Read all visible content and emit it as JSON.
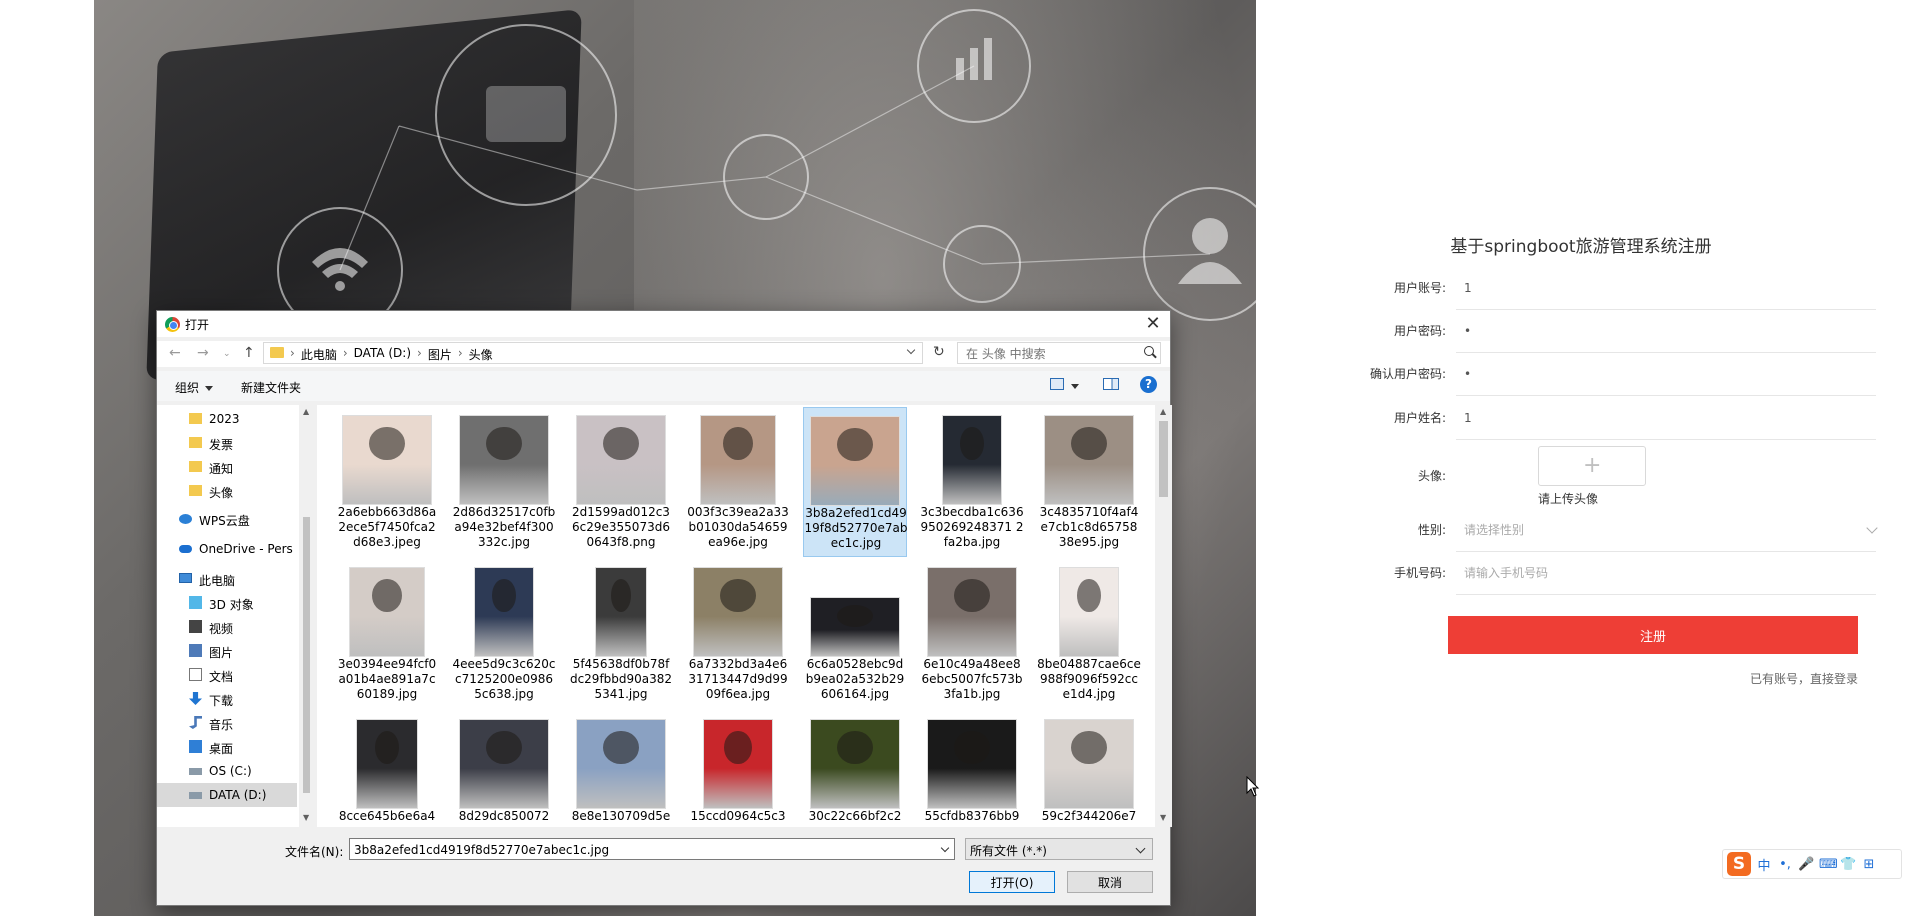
{
  "register": {
    "title": "基于springboot旅游管理系统注册",
    "fields": [
      {
        "label": "用户账号:",
        "value": "1"
      },
      {
        "label": "用户密码:",
        "value": "•"
      },
      {
        "label": "确认用户密码:",
        "value": "•"
      },
      {
        "label": "用户姓名:",
        "value": "1"
      }
    ],
    "avatar_label": "头像:",
    "avatar_hint": "请上传头像",
    "avatar_plus": "+",
    "gender_label": "性别:",
    "gender_placeholder": "请选择性别",
    "phone_label": "手机号码:",
    "phone_placeholder": "请输入手机号码",
    "submit_label": "注册",
    "login_link": "已有账号，直接登录"
  },
  "ime": {
    "logo": "S",
    "items": [
      "中",
      "•,",
      "🎤",
      "⌨",
      "👕",
      "⊞"
    ]
  },
  "dialog": {
    "title": "打开",
    "close": "✕",
    "address": {
      "crumbs": [
        "此电脑",
        "DATA (D:)",
        "图片",
        "头像"
      ],
      "separator": "›",
      "search_placeholder": "在 头像 中搜索"
    },
    "toolbar": {
      "organize": "组织",
      "new_folder": "新建文件夹",
      "help": "?"
    },
    "nav_items": [
      {
        "label": "2023",
        "icon": "folder-icon"
      },
      {
        "label": "发票",
        "icon": "folder-icon"
      },
      {
        "label": "通知",
        "icon": "folder-icon"
      },
      {
        "label": "头像",
        "icon": "folder-icon"
      },
      {
        "label": "WPS云盘",
        "icon": "cloud-icon"
      },
      {
        "label": "OneDrive - Pers",
        "icon": "onedrive-icon"
      },
      {
        "label": "此电脑",
        "icon": "computer-icon"
      },
      {
        "label": "3D 对象",
        "icon": "cube-icon"
      },
      {
        "label": "视频",
        "icon": "video-icon"
      },
      {
        "label": "图片",
        "icon": "picture-icon"
      },
      {
        "label": "文档",
        "icon": "document-icon"
      },
      {
        "label": "下载",
        "icon": "download-icon"
      },
      {
        "label": "音乐",
        "icon": "music-icon"
      },
      {
        "label": "桌面",
        "icon": "desktop-icon"
      },
      {
        "label": "OS (C:)",
        "icon": "drive-icon"
      },
      {
        "label": "DATA (D:)",
        "icon": "drive-icon",
        "selected": true
      }
    ],
    "files": [
      {
        "name": "2a6ebb663d86a2ece5f7450fca2d68e3.jpeg",
        "color": "#e9d9cf"
      },
      {
        "name": "2d86d32517c0fba94e32bef4f300332c.jpg",
        "color": "#6f6f6f"
      },
      {
        "name": "2d1599ad012c36c29e355073d60643f8.png",
        "color": "#c9c1c4"
      },
      {
        "name": "003f3c39ea2a33b01030da54659ea96e.jpg",
        "color": "#b59784"
      },
      {
        "name": "3b8a2efed1cd4919f8d52770e7abec1c.jpg",
        "color": "#c9a48f",
        "selected": true
      },
      {
        "name": "3c3becdba1c636950269248371 2fa2ba.jpg",
        "color": "#252a33"
      },
      {
        "name": "3c4835710f4af4e7cb1c8d6575838e95.jpg",
        "color": "#9c8f84"
      },
      {
        "name": "3e0394ee94fcf0a01b4ae891a7c60189.jpg",
        "color": "#d4ccc7"
      },
      {
        "name": "4eee5d9c3c620cc7125200e09865c638.jpg",
        "color": "#2d3a55"
      },
      {
        "name": "5f45638df0b78fdc29fbbd90a3825341.jpg",
        "color": "#3b3b3b"
      },
      {
        "name": "6a7332bd3a4e631713447d9d9909f6ea.jpg",
        "color": "#8c8066"
      },
      {
        "name": "6c6a0528ebc9db9ea02a532b29606164.jpg",
        "color": "#1f1f24"
      },
      {
        "name": "6e10c49a48ee86ebc5007fc573b3fa1b.jpg",
        "color": "#7a6f6a"
      },
      {
        "name": "8be04887cae6ce988f9096f592cce1d4.jpg",
        "color": "#efe9e6"
      },
      {
        "name": "8cce645b6e6a4",
        "color": "#2b2b2e"
      },
      {
        "name": "8d29dc850072",
        "color": "#3c3e48"
      },
      {
        "name": "8e8e130709d5e",
        "color": "#8aa1c2"
      },
      {
        "name": "15ccd0964c5c3",
        "color": "#c8262b"
      },
      {
        "name": "30c22c66bf2c2",
        "color": "#3b4a1f"
      },
      {
        "name": "55cfdb8376bb9",
        "color": "#1a1a1a"
      },
      {
        "name": "59c2f344206e7",
        "color": "#d9d3cf"
      }
    ],
    "filename_label": "文件名(N):",
    "filename_value": "3b8a2efed1cd4919f8d52770e7abec1c.jpg",
    "filetype": "所有文件 (*.*)",
    "open_label": "打开(O)",
    "cancel_label": "取消"
  }
}
